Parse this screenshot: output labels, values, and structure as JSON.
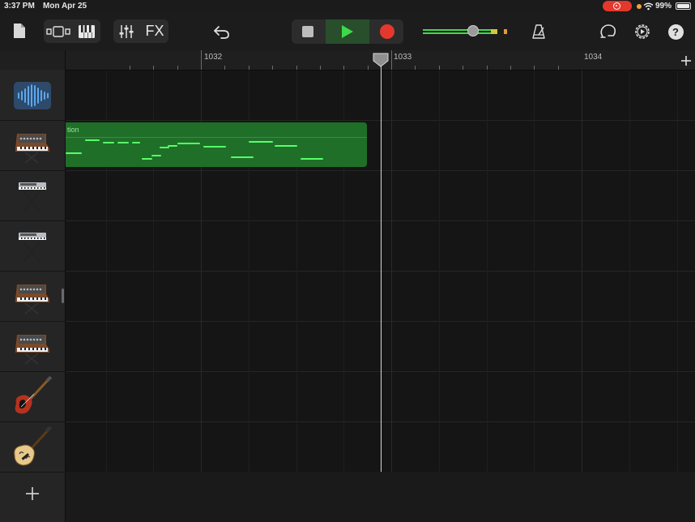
{
  "status_bar": {
    "time": "3:37 PM",
    "date": "Mon Apr 25",
    "battery_percent": "99%",
    "battery_level": 0.99
  },
  "toolbar": {
    "fx_label": "FX",
    "master_volume_level": 0.5
  },
  "ruler": {
    "bars": [
      "1032",
      "1033",
      "1034"
    ]
  },
  "tracks": [
    {
      "name": "audio-recorder-track",
      "icon": "waveform-icon"
    },
    {
      "name": "synth-track-1",
      "icon": "analog-synth-icon"
    },
    {
      "name": "keyboard-track-1",
      "icon": "keyboard-stand-icon"
    },
    {
      "name": "keyboard-track-2",
      "icon": "keyboard-stand-icon"
    },
    {
      "name": "synth-track-2",
      "icon": "analog-synth-icon"
    },
    {
      "name": "synth-track-3",
      "icon": "analog-synth-icon"
    },
    {
      "name": "bass-track",
      "icon": "bass-guitar-icon"
    },
    {
      "name": "guitar-track",
      "icon": "hollow-body-guitar-icon"
    }
  ],
  "region": {
    "title": "tion",
    "track": "synth-track-1",
    "color": "#1f6f28"
  },
  "colors": {
    "accent_green": "#57ff6a",
    "record_red": "#e5382d",
    "play_green": "#3fd94a"
  }
}
